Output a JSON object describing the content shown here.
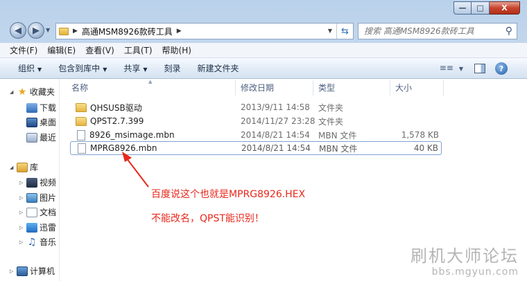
{
  "window": {
    "minimize": "—",
    "maximize": "□",
    "close": "X"
  },
  "navbar": {
    "breadcrumb": "高通MSM8926款砖工具",
    "search_placeholder": "搜索 高通MSM8926款砖工具"
  },
  "menubar": [
    "文件(F)",
    "编辑(E)",
    "查看(V)",
    "工具(T)",
    "帮助(H)"
  ],
  "cmdbar": {
    "organize": "组织",
    "include": "包含到库中",
    "share": "共享",
    "burn": "刻录",
    "new_folder": "新建文件夹"
  },
  "sidebar": {
    "favorites": "收藏夹",
    "downloads": "下载",
    "desktop": "桌面",
    "recent": "最近",
    "libraries": "库",
    "videos": "视频",
    "pictures": "图片",
    "documents": "文档",
    "thunder": "迅雷",
    "music": "音乐",
    "computer": "计算机"
  },
  "columns": {
    "name": "名称",
    "date": "修改日期",
    "type": "类型",
    "size": "大小"
  },
  "files": [
    {
      "name": "QHSUSB驱动",
      "date": "2013/9/11 14:58",
      "type": "文件夹",
      "size": "",
      "kind": "folder"
    },
    {
      "name": "QPST2.7.399",
      "date": "2014/11/27 23:28",
      "type": "文件夹",
      "size": "",
      "kind": "folder"
    },
    {
      "name": "8926_msimage.mbn",
      "date": "2014/8/21 14:54",
      "type": "MBN 文件",
      "size": "1,578 KB",
      "kind": "file"
    },
    {
      "name": "MPRG8926.mbn",
      "date": "2014/8/21 14:54",
      "type": "MBN 文件",
      "size": "40 KB",
      "kind": "file"
    }
  ],
  "annotation": {
    "line1": "百度说这个也就是MPRG8926.HEX",
    "line2": "不能改名，QPST能识别！",
    "color": "#e8281c"
  },
  "watermark": {
    "line1": "刷机大师论坛",
    "line2": "bbs.mgyun.com"
  }
}
